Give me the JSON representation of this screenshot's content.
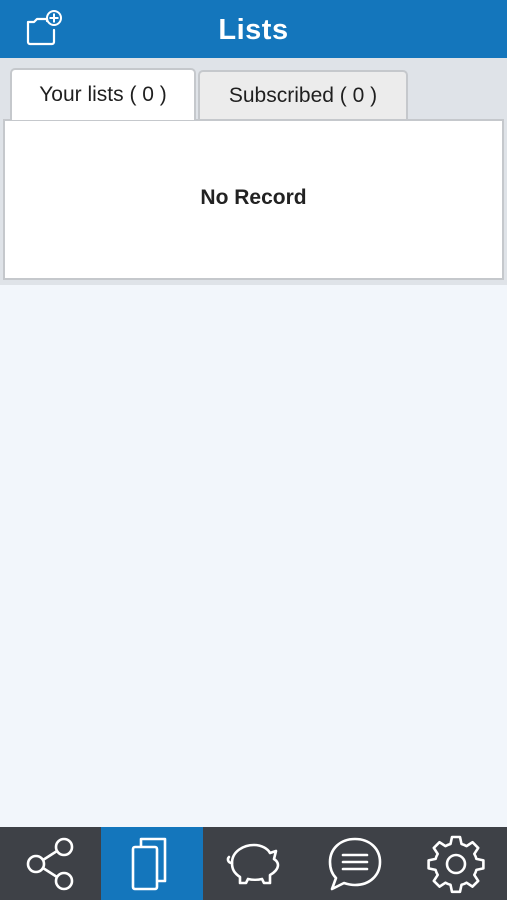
{
  "header": {
    "title": "Lists",
    "new_list_icon": "folder-plus-icon"
  },
  "tabs": [
    {
      "label": "Your lists ( 0 )",
      "active": true
    },
    {
      "label": "Subscribed ( 0 )",
      "active": false
    }
  ],
  "panel": {
    "empty_message": "No Record"
  },
  "bottom_nav": {
    "items": [
      {
        "icon": "share-icon",
        "active": false
      },
      {
        "icon": "lists-icon",
        "active": true
      },
      {
        "icon": "piggy-bank-icon",
        "active": false
      },
      {
        "icon": "chat-icon",
        "active": false
      },
      {
        "icon": "gear-icon",
        "active": false
      }
    ]
  },
  "colors": {
    "header_bg": "#1476bc",
    "nav_bg": "#3e4147",
    "nav_active_bg": "#1476bc",
    "page_bg": "#f2f6fb"
  }
}
